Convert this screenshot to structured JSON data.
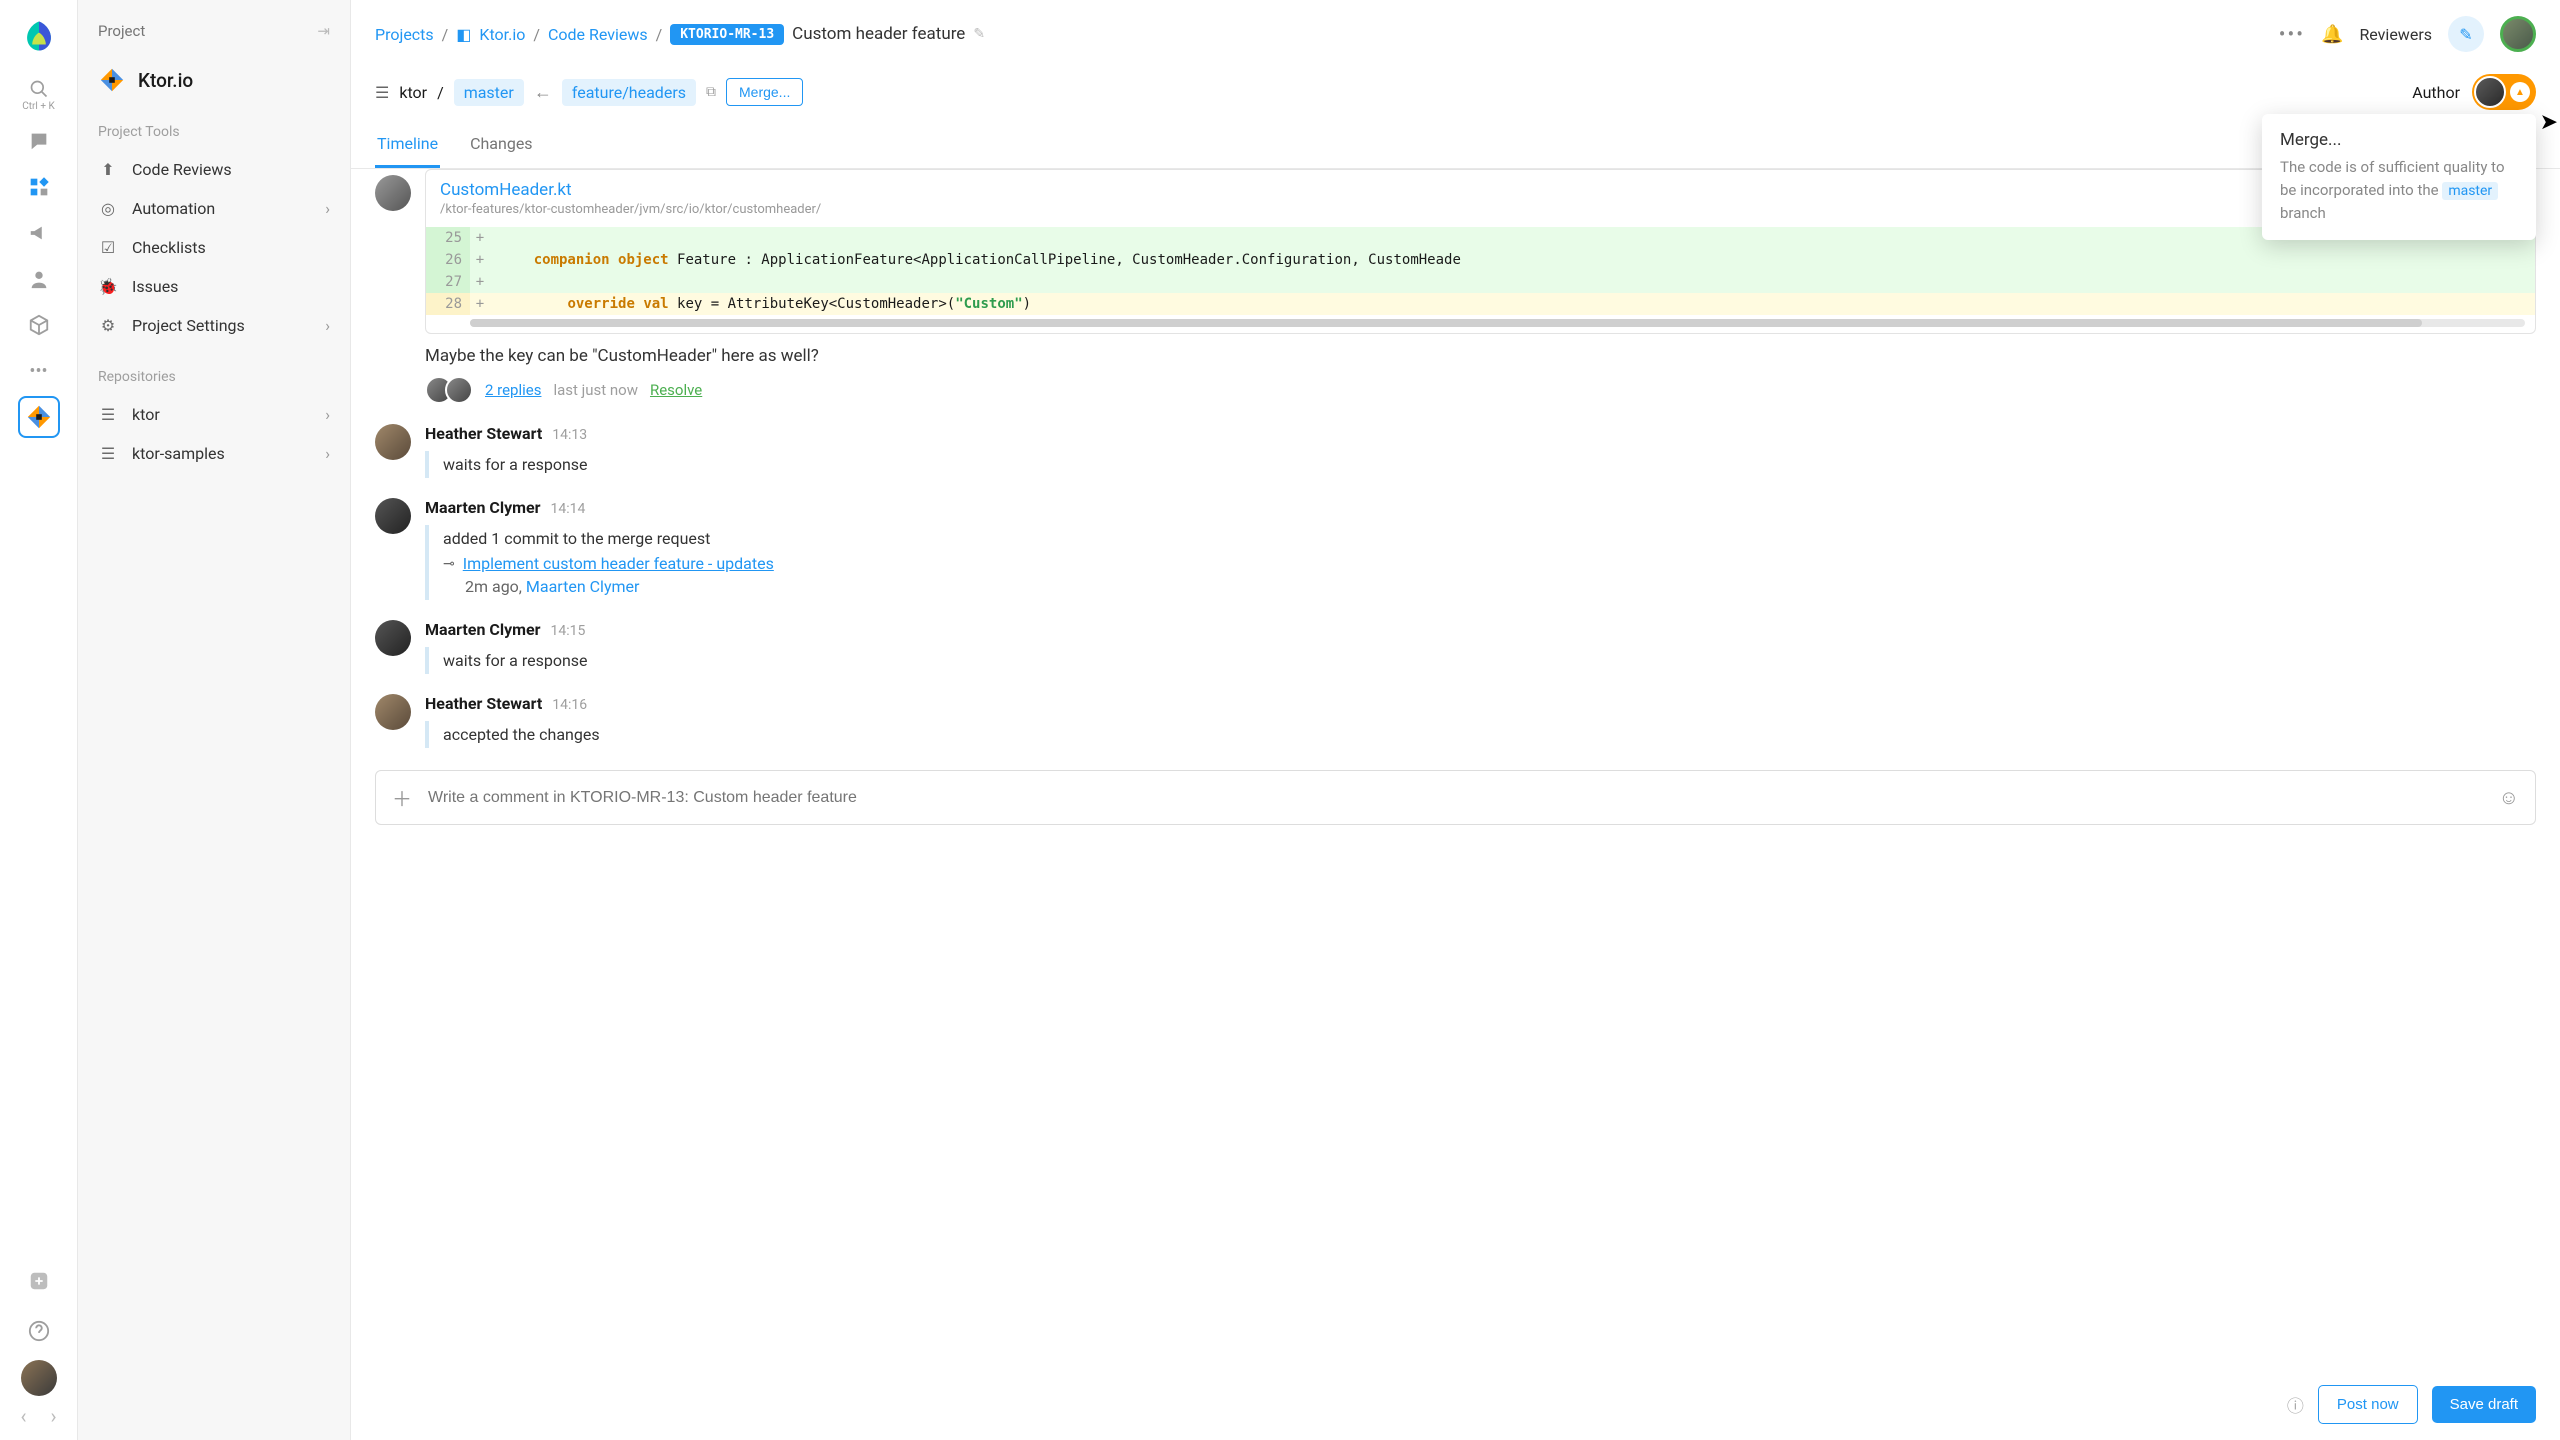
{
  "rail": {
    "search_hint": "Ctrl + K"
  },
  "sidebar": {
    "header": "Project",
    "project_name": "Ktor.io",
    "tools_label": "Project Tools",
    "tools": [
      {
        "label": "Code Reviews"
      },
      {
        "label": "Automation"
      },
      {
        "label": "Checklists"
      },
      {
        "label": "Issues"
      },
      {
        "label": "Project Settings"
      }
    ],
    "repos_label": "Repositories",
    "repos": [
      {
        "label": "ktor"
      },
      {
        "label": "ktor-samples"
      }
    ]
  },
  "breadcrumb": {
    "projects": "Projects",
    "project": "Ktor.io",
    "section": "Code Reviews",
    "mr_id": "KTORIO-MR-13",
    "mr_title": "Custom header feature"
  },
  "topbar": {
    "reviewers": "Reviewers",
    "author": "Author"
  },
  "branch": {
    "repo": "ktor",
    "target": "master",
    "source": "feature/headers",
    "merge": "Merge..."
  },
  "tabs": {
    "timeline": "Timeline",
    "changes": "Changes"
  },
  "code_card": {
    "file": "CustomHeader.kt",
    "path": "/ktor-features/ktor-customheader/jvm/src/io/ktor/customheader/",
    "lines": {
      "25": "",
      "26": "    companion object Feature : ApplicationFeature<ApplicationCallPipeline, CustomHeader.Configuration, CustomHeade",
      "27": "",
      "28": "        override val key = AttributeKey<CustomHeader>(\"Custom\")"
    },
    "comment": "Maybe the key can be \"CustomHeader\" here as well?",
    "replies": "2 replies",
    "replies_meta": "last just now",
    "resolve": "Resolve"
  },
  "events": [
    {
      "author": "Heather Stewart",
      "time": "14:13",
      "msg": "waits for a response",
      "avatar": "ev-brown"
    },
    {
      "author": "Maarten Clymer",
      "time": "14:14",
      "msg": "added 1 commit to the merge request",
      "commit": "Implement custom header feature - updates",
      "commit_meta_time": "2m ago, ",
      "commit_meta_author": "Maarten Clymer",
      "avatar": "ev-dark"
    },
    {
      "author": "Maarten Clymer",
      "time": "14:15",
      "msg": "waits for a response",
      "avatar": "ev-dark"
    },
    {
      "author": "Heather Stewart",
      "time": "14:16",
      "msg": "accepted the changes",
      "avatar": "ev-brown"
    }
  ],
  "comment_box": {
    "placeholder": "Write a comment in KTORIO-MR-13: Custom header feature"
  },
  "footer": {
    "post": "Post now",
    "draft": "Save draft"
  },
  "popover": {
    "title": "Merge...",
    "body_pre": "The code is of sufficient quality to be incorporated into the ",
    "branch": "master",
    "body_post": " branch"
  }
}
